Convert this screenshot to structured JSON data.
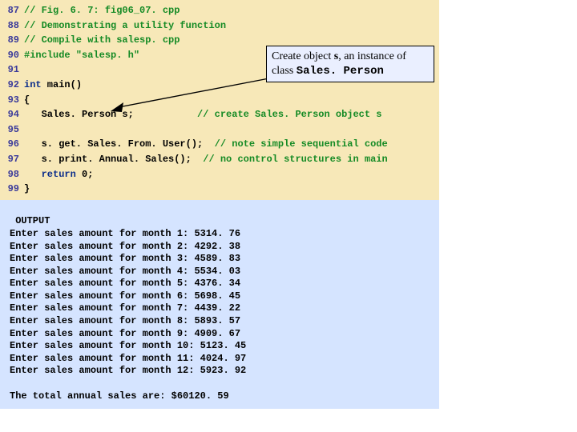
{
  "code": {
    "lines": [
      {
        "num": "87",
        "segments": [
          {
            "cls": "comment",
            "text": "// Fig. 6. 7: fig06_07. cpp"
          }
        ]
      },
      {
        "num": "88",
        "segments": [
          {
            "cls": "comment",
            "text": "// Demonstrating a utility function"
          }
        ]
      },
      {
        "num": "89",
        "segments": [
          {
            "cls": "comment",
            "text": "// Compile with salesp. cpp"
          }
        ]
      },
      {
        "num": "90",
        "segments": [
          {
            "cls": "preproc",
            "text": "#include \"salesp. h\""
          }
        ]
      },
      {
        "num": "91",
        "segments": [
          {
            "cls": "ident",
            "text": ""
          }
        ]
      },
      {
        "num": "92",
        "segments": [
          {
            "cls": "keyword",
            "text": "int"
          },
          {
            "cls": "ident",
            "text": " main()"
          }
        ]
      },
      {
        "num": "93",
        "segments": [
          {
            "cls": "ident",
            "text": "{"
          }
        ]
      },
      {
        "num": "94",
        "segments": [
          {
            "cls": "ident",
            "text": "   Sales. Person s;           "
          },
          {
            "cls": "comment",
            "text": "// create Sales. Person object s"
          }
        ]
      },
      {
        "num": "95",
        "segments": [
          {
            "cls": "ident",
            "text": ""
          }
        ]
      },
      {
        "num": "96",
        "segments": [
          {
            "cls": "ident",
            "text": "   s. get. Sales. From. User();  "
          },
          {
            "cls": "comment",
            "text": "// note simple sequential code"
          }
        ]
      },
      {
        "num": "97",
        "segments": [
          {
            "cls": "ident",
            "text": "   s. print. Annual. Sales();  "
          },
          {
            "cls": "comment",
            "text": "// no control structures in main"
          }
        ]
      },
      {
        "num": "98",
        "segments": [
          {
            "cls": "ident",
            "text": "   "
          },
          {
            "cls": "keyword",
            "text": "return"
          },
          {
            "cls": "ident",
            "text": " 0;"
          }
        ]
      },
      {
        "num": "99",
        "segments": [
          {
            "cls": "ident",
            "text": "}"
          }
        ]
      }
    ]
  },
  "callout": {
    "prefix": "Create object ",
    "bold1": "s",
    "mid": ", an instance of class ",
    "bold2": "Sales. Person"
  },
  "output": {
    "header": " OUTPUT",
    "lines": [
      "Enter sales amount for month 1: 5314. 76",
      "Enter sales amount for month 2: 4292. 38",
      "Enter sales amount for month 3: 4589. 83",
      "Enter sales amount for month 4: 5534. 03",
      "Enter sales amount for month 5: 4376. 34",
      "Enter sales amount for month 6: 5698. 45",
      "Enter sales amount for month 7: 4439. 22",
      "Enter sales amount for month 8: 5893. 57",
      "Enter sales amount for month 9: 4909. 67",
      "Enter sales amount for month 10: 5123. 45",
      "Enter sales amount for month 11: 4024. 97",
      "Enter sales amount for month 12: 5923. 92"
    ],
    "footer": "The total annual sales are: $60120. 59"
  }
}
